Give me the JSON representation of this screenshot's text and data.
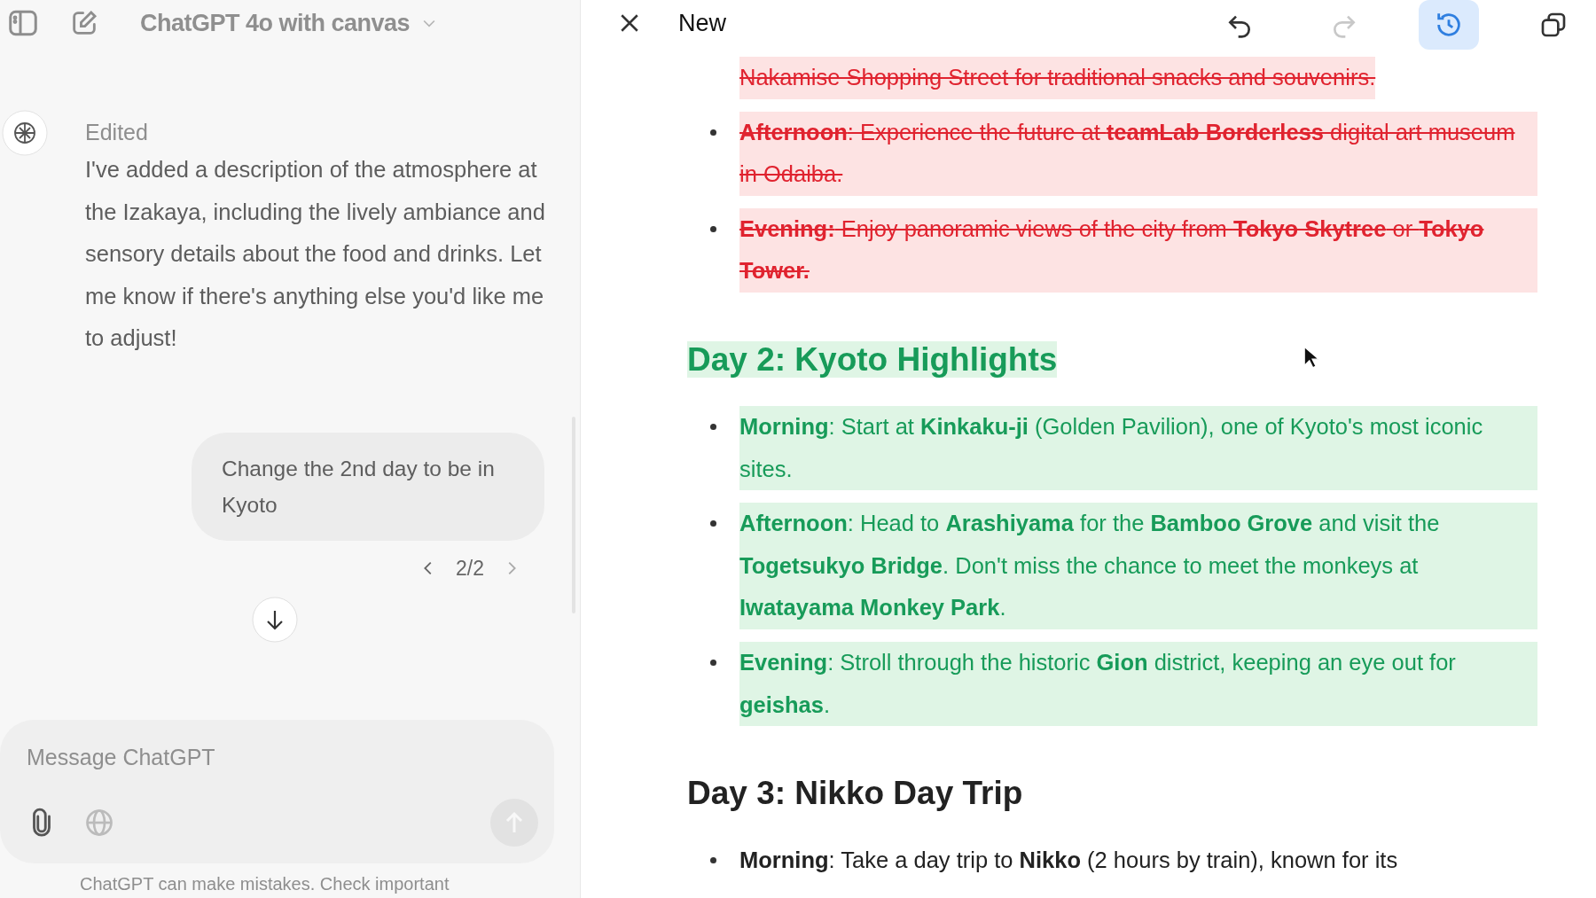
{
  "chat": {
    "model": "ChatGPT 4o with canvas",
    "messages": [
      {
        "kind": "assistant",
        "status": "Edited",
        "text": "I've added a description of the atmosphere at the Izakaya, including the lively ambiance and sensory details about the food and drinks. Let me know if there's anything else you'd like me to adjust!"
      },
      {
        "kind": "user",
        "text": "Change the 2nd day to be in Kyoto",
        "pager": "2/2"
      }
    ],
    "composer": {
      "placeholder": "Message ChatGPT"
    },
    "disclaimer": "ChatGPT can make mistakes. Check important"
  },
  "canvas": {
    "title": "New",
    "toolbar": [
      {
        "kind": "undo",
        "disabled": false,
        "selected": false
      },
      {
        "kind": "redo",
        "disabled": true,
        "selected": false
      },
      {
        "kind": "history",
        "disabled": false,
        "selected": true
      },
      {
        "kind": "copy",
        "disabled": false,
        "selected": false
      }
    ],
    "blocks": [
      {
        "kind": "continuation",
        "deleted": true,
        "inserted": false,
        "text": "Nakamise Shopping Street for traditional snacks and souvenirs."
      },
      {
        "kind": "bullet",
        "deleted": true,
        "inserted": false,
        "text": "**Afternoon**: Experience the future at **teamLab Borderless** digital art museum in Odaiba."
      },
      {
        "kind": "bullet",
        "deleted": true,
        "inserted": false,
        "text": "**Evening:** Enjoy panoramic views of the city from **Tokyo Skytree** or **Tokyo Tower.**"
      },
      {
        "kind": "heading",
        "deleted": false,
        "inserted": true,
        "text": "Day 2: Kyoto Highlights"
      },
      {
        "kind": "bullet",
        "deleted": false,
        "inserted": true,
        "text": "**Morning**: Start at **Kinkaku-ji** (Golden Pavilion), one of Kyoto's most iconic sites."
      },
      {
        "kind": "bullet",
        "deleted": false,
        "inserted": true,
        "text": "**Afternoon**: Head to **Arashiyama** for the **Bamboo Grove** and visit the **Togetsukyo Bridge**. Don't miss the chance to meet the monkeys at **Iwatayama Monkey Park**."
      },
      {
        "kind": "bullet",
        "deleted": false,
        "inserted": true,
        "text": "**Evening**: Stroll through the historic **Gion** district, keeping an eye out for **geishas**."
      },
      {
        "kind": "heading",
        "deleted": false,
        "inserted": false,
        "text": "Day 3: Nikko Day Trip"
      },
      {
        "kind": "bullet",
        "deleted": false,
        "inserted": false,
        "text": "**Morning**: Take a day trip to **Nikko** (2 hours by train), known for its"
      }
    ]
  }
}
